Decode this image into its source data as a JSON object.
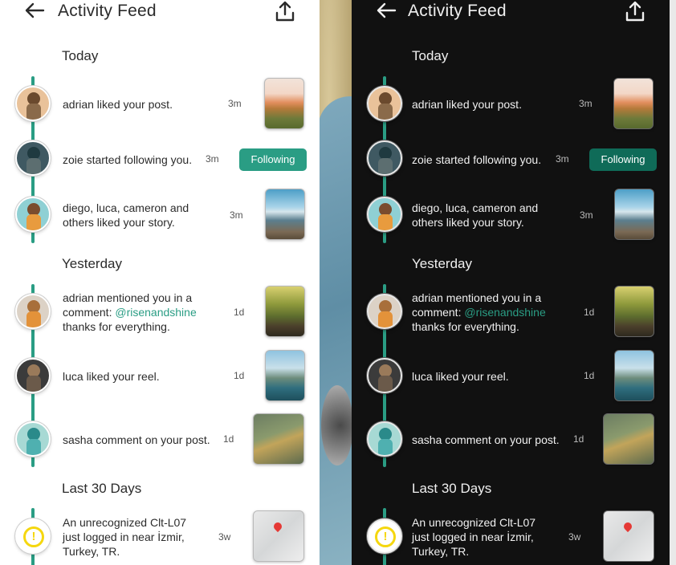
{
  "header": {
    "title": "Activity Feed"
  },
  "sections": {
    "today": "Today",
    "yesterday": "Yesterday",
    "last30": "Last 30 Days"
  },
  "items": [
    {
      "text": "adrian liked your post.",
      "time": "3m"
    },
    {
      "text": "zoie started following you.",
      "time": "3m",
      "button": "Following"
    },
    {
      "text_line1": "diego, luca, cameron and",
      "text_line2": "others liked your story.",
      "time": "3m"
    },
    {
      "line1": "adrian mentioned you in a",
      "line2_prefix": "comment: ",
      "mention": "@risenandshine",
      "line3": "thanks for everything.",
      "time": "1d"
    },
    {
      "text": "luca liked your reel.",
      "time": "1d"
    },
    {
      "text": "sasha comment on your post.",
      "time": "1d"
    },
    {
      "line1": "An unrecognized Clt-L07",
      "line2": "just logged in near İzmir,",
      "line3": "Turkey, TR.",
      "time": "3w"
    }
  ],
  "colors": {
    "accent": "#2a9d84",
    "accent_dark": "#0f6b58",
    "alert": "#f5d70f"
  },
  "icons": {
    "back": "arrow-left-icon",
    "share": "share-upload-icon",
    "alert": "exclamation-circle-icon"
  }
}
